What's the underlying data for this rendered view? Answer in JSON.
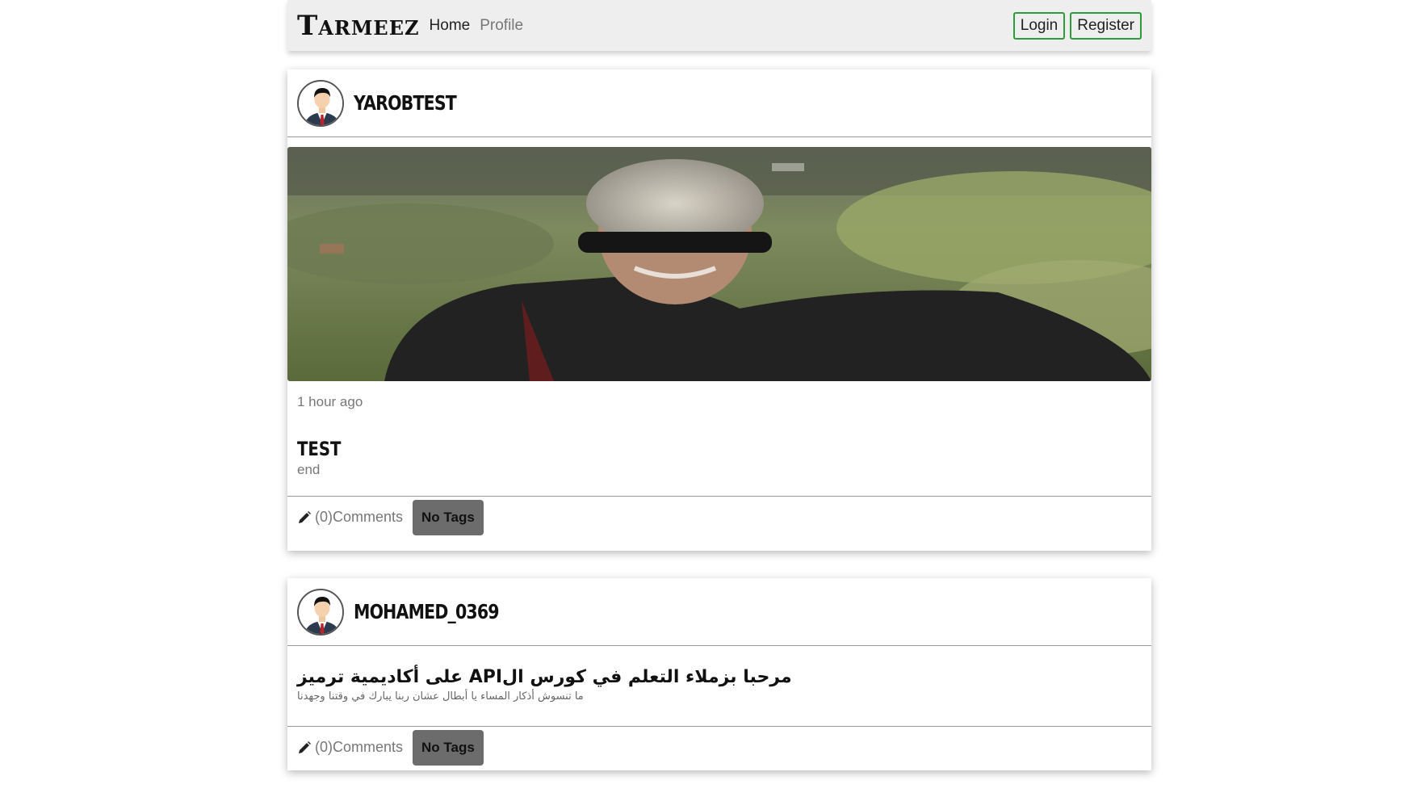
{
  "navbar": {
    "brand": "Tarmeez",
    "links": [
      "Home",
      "Profile"
    ],
    "login_label": "Login",
    "register_label": "Register"
  },
  "posts": [
    {
      "username": "YAROBTEST",
      "time": "1 hour ago",
      "title": "TEST",
      "body": "end",
      "comments": "(0)Comments",
      "tag": "No Tags"
    },
    {
      "username": "MOHAMED_0369",
      "title": "مرحبا بزملاء التعلم في كورس الAPI على أكاديمية ترميز",
      "body": "ما تنسوش أذكار المساء يا أبطال عشان ربنا يبارك في وقتنا وجهدنا",
      "comments": "(0)Comments",
      "tag": "No Tags"
    }
  ],
  "colors": {
    "navbar_bg": "#eeeeee",
    "button_border": "#2e9b3a",
    "tag_bg": "#6c6c6c"
  },
  "icons": [
    "pencil-icon",
    "avatar-icon"
  ]
}
